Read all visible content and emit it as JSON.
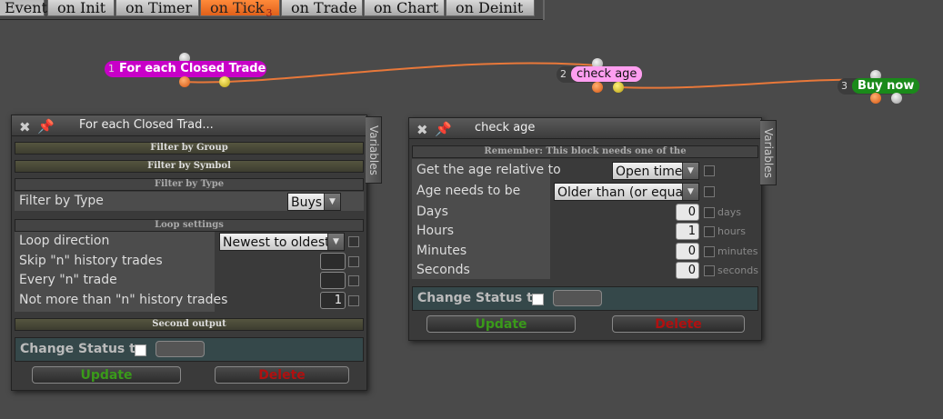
{
  "tabs": [
    {
      "label": "Events"
    },
    {
      "label": "on Init"
    },
    {
      "label": "on Timer"
    },
    {
      "label": "on Tick",
      "badge": "3"
    },
    {
      "label": "on Trade"
    },
    {
      "label": "on Chart"
    },
    {
      "label": "on Deinit"
    }
  ],
  "nodes": [
    {
      "num": "1",
      "label": "For each Closed Trade",
      "color": "#c800c8"
    },
    {
      "num": "2",
      "label": "check age",
      "color": "#ff9ef0"
    },
    {
      "num": "3",
      "label": "Buy now",
      "color": "#1a8a1a"
    }
  ],
  "panel1": {
    "title": "For each Closed Trad...",
    "variables": "Variables",
    "sections": {
      "filter_group": "Filter by Group",
      "filter_symbol": "Filter by Symbol",
      "filter_type": "Filter by Type",
      "loop": "Loop settings",
      "second": "Second output"
    },
    "filter_type_label": "Filter by Type",
    "filter_type_value": "Buys",
    "loop_direction_label": "Loop direction",
    "loop_direction_value": "Newest to oldest",
    "skip_label": "Skip \"n\" history trades",
    "every_label": "Every \"n\" trade",
    "not_more_label": "Not more than \"n\" history trades",
    "not_more_value": "1",
    "change_status": "Change Status to",
    "update": "Update",
    "delete": "Delete"
  },
  "panel2": {
    "title": "check age",
    "variables": "Variables",
    "remember": "Remember: This block needs one of the",
    "age_rel_label": "Get the age relative to",
    "age_rel_value": "Open time",
    "age_needs_label": "Age needs to be",
    "age_needs_value": "Older than (or equal)",
    "days_label": "Days",
    "days_value": "0",
    "days_unit": "days",
    "hours_label": "Hours",
    "hours_value": "1",
    "hours_unit": "hours",
    "minutes_label": "Minutes",
    "minutes_value": "0",
    "minutes_unit": "minutes",
    "seconds_label": "Seconds",
    "seconds_value": "0",
    "seconds_unit": "seconds",
    "change_status": "Change Status to",
    "update": "Update",
    "delete": "Delete"
  }
}
